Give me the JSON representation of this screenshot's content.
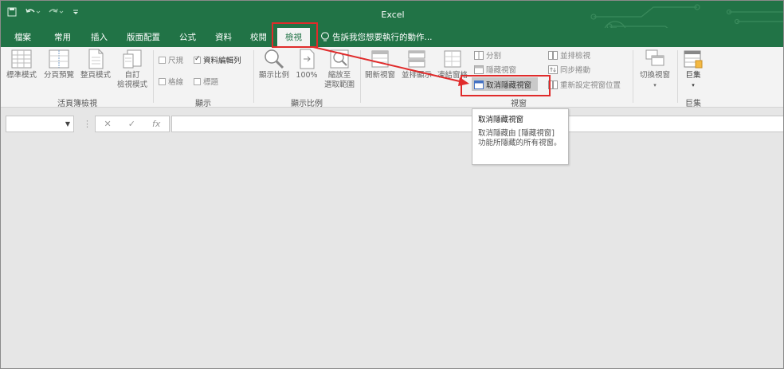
{
  "app_title": "Excel",
  "colors": {
    "accent": "#217346",
    "highlight": "#e02b2b"
  },
  "qat": [
    "save-icon",
    "undo-icon",
    "redo-icon",
    "customize-icon"
  ],
  "tabs": [
    "檔案",
    "常用",
    "插入",
    "版面配置",
    "公式",
    "資料",
    "校閱",
    "檢視"
  ],
  "active_tab": "檢視",
  "tell_me": "告訴我您想要執行的動作...",
  "ribbon": {
    "workbook_views": {
      "label": "活頁簿檢視",
      "normal": "標準模式",
      "page_break": "分頁預覽",
      "page_layout": "整頁模式",
      "custom_1": "自訂",
      "custom_2": "檢視模式"
    },
    "show": {
      "label": "顯示",
      "ruler": "尺規",
      "formula_bar": "資料編輯列",
      "gridlines": "格線",
      "headings": "標題"
    },
    "zoom": {
      "label": "顯示比例",
      "zoom": "顯示比例",
      "hundred": "100%",
      "to_selection_1": "縮放至",
      "to_selection_2": "選取範圍"
    },
    "window": {
      "label": "視窗",
      "new_window": "開新視窗",
      "arrange_all": "並排顯示",
      "freeze_panes": "凍結窗格",
      "split": "分割",
      "hide": "隱藏視窗",
      "unhide": "取消隱藏視窗",
      "side_by_side": "並排檢視",
      "sync_scroll": "同步捲動",
      "reset_position": "重新設定視窗位置",
      "switch_windows": "切換視窗"
    },
    "macros": {
      "label": "巨集",
      "macros": "巨集"
    }
  },
  "formula_bar": {
    "cancel": "✕",
    "enter": "✓",
    "fx": "fx"
  },
  "tooltip": {
    "title": "取消隱藏視窗",
    "body": "取消隱藏由 [隱藏視窗] 功能所隱藏的所有視窗。"
  }
}
